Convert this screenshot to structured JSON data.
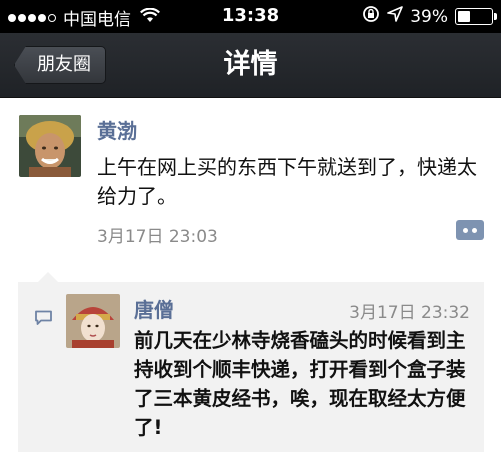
{
  "status_bar": {
    "carrier": "中国电信",
    "time": "13:38",
    "battery_percent": "39%",
    "battery_level": 0.39,
    "icons": [
      "signal-dots-icon",
      "wifi-icon",
      "rotation-lock-icon",
      "location-arrow-icon",
      "battery-icon"
    ]
  },
  "nav": {
    "back_label": "朋友圈",
    "title": "详情"
  },
  "post": {
    "author": "黄渤",
    "text": "上午在网上买的东西下午就送到了，快递太给力了。",
    "time": "3月17日 23:03"
  },
  "comment": {
    "author": "唐僧",
    "time": "3月17日 23:32",
    "text": "前几天在少林寺烧香磕头的时候看到主持收到个顺丰快递，打开看到个盒子装了三本黄皮经书，唉，现在取经太方便了!"
  },
  "colors": {
    "name_link": "#5a6f96",
    "nav_bg": "#26292d",
    "comment_bg": "#f2f2f2",
    "comment_button": "#7e93b1"
  }
}
